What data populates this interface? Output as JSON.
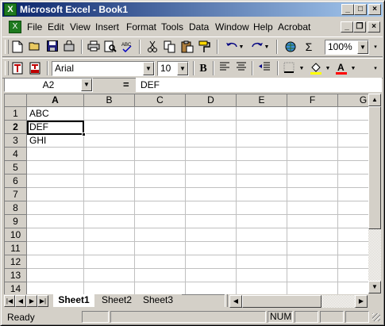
{
  "window": {
    "title": "Microsoft Excel - Book1",
    "app_icon": "excel-icon"
  },
  "title_buttons": {
    "minimize": "_",
    "maximize": "□",
    "close": "×"
  },
  "menubar": {
    "items": [
      "File",
      "Edit",
      "View",
      "Insert",
      "Format",
      "Tools",
      "Data",
      "Window",
      "Help",
      "Acrobat"
    ],
    "doc_buttons": {
      "minimize": "_",
      "restore": "❐",
      "close": "×"
    }
  },
  "toolbar": {
    "zoom": "100%",
    "font_name": "Arial",
    "font_size": "10",
    "bold_label": "B",
    "sigma": "Σ",
    "font_color": "#ff0000",
    "fill_color": "#ffff00"
  },
  "formula_bar": {
    "name_box": "A2",
    "equals": "=",
    "content": "DEF"
  },
  "grid": {
    "columns": [
      "A",
      "B",
      "C",
      "D",
      "E",
      "F",
      "G"
    ],
    "selected_column": "A",
    "rows": [
      "1",
      "2",
      "3",
      "4",
      "5",
      "6",
      "7",
      "8",
      "9",
      "10",
      "11",
      "12",
      "13",
      "14"
    ],
    "selected_row": "2",
    "cells": {
      "A1": "ABC",
      "A2": "DEF",
      "A3": "GHI"
    }
  },
  "sheets": {
    "tabs": [
      "Sheet1",
      "Sheet2",
      "Sheet3"
    ],
    "active": "Sheet1"
  },
  "statusbar": {
    "status": "Ready",
    "num": "NUM"
  }
}
